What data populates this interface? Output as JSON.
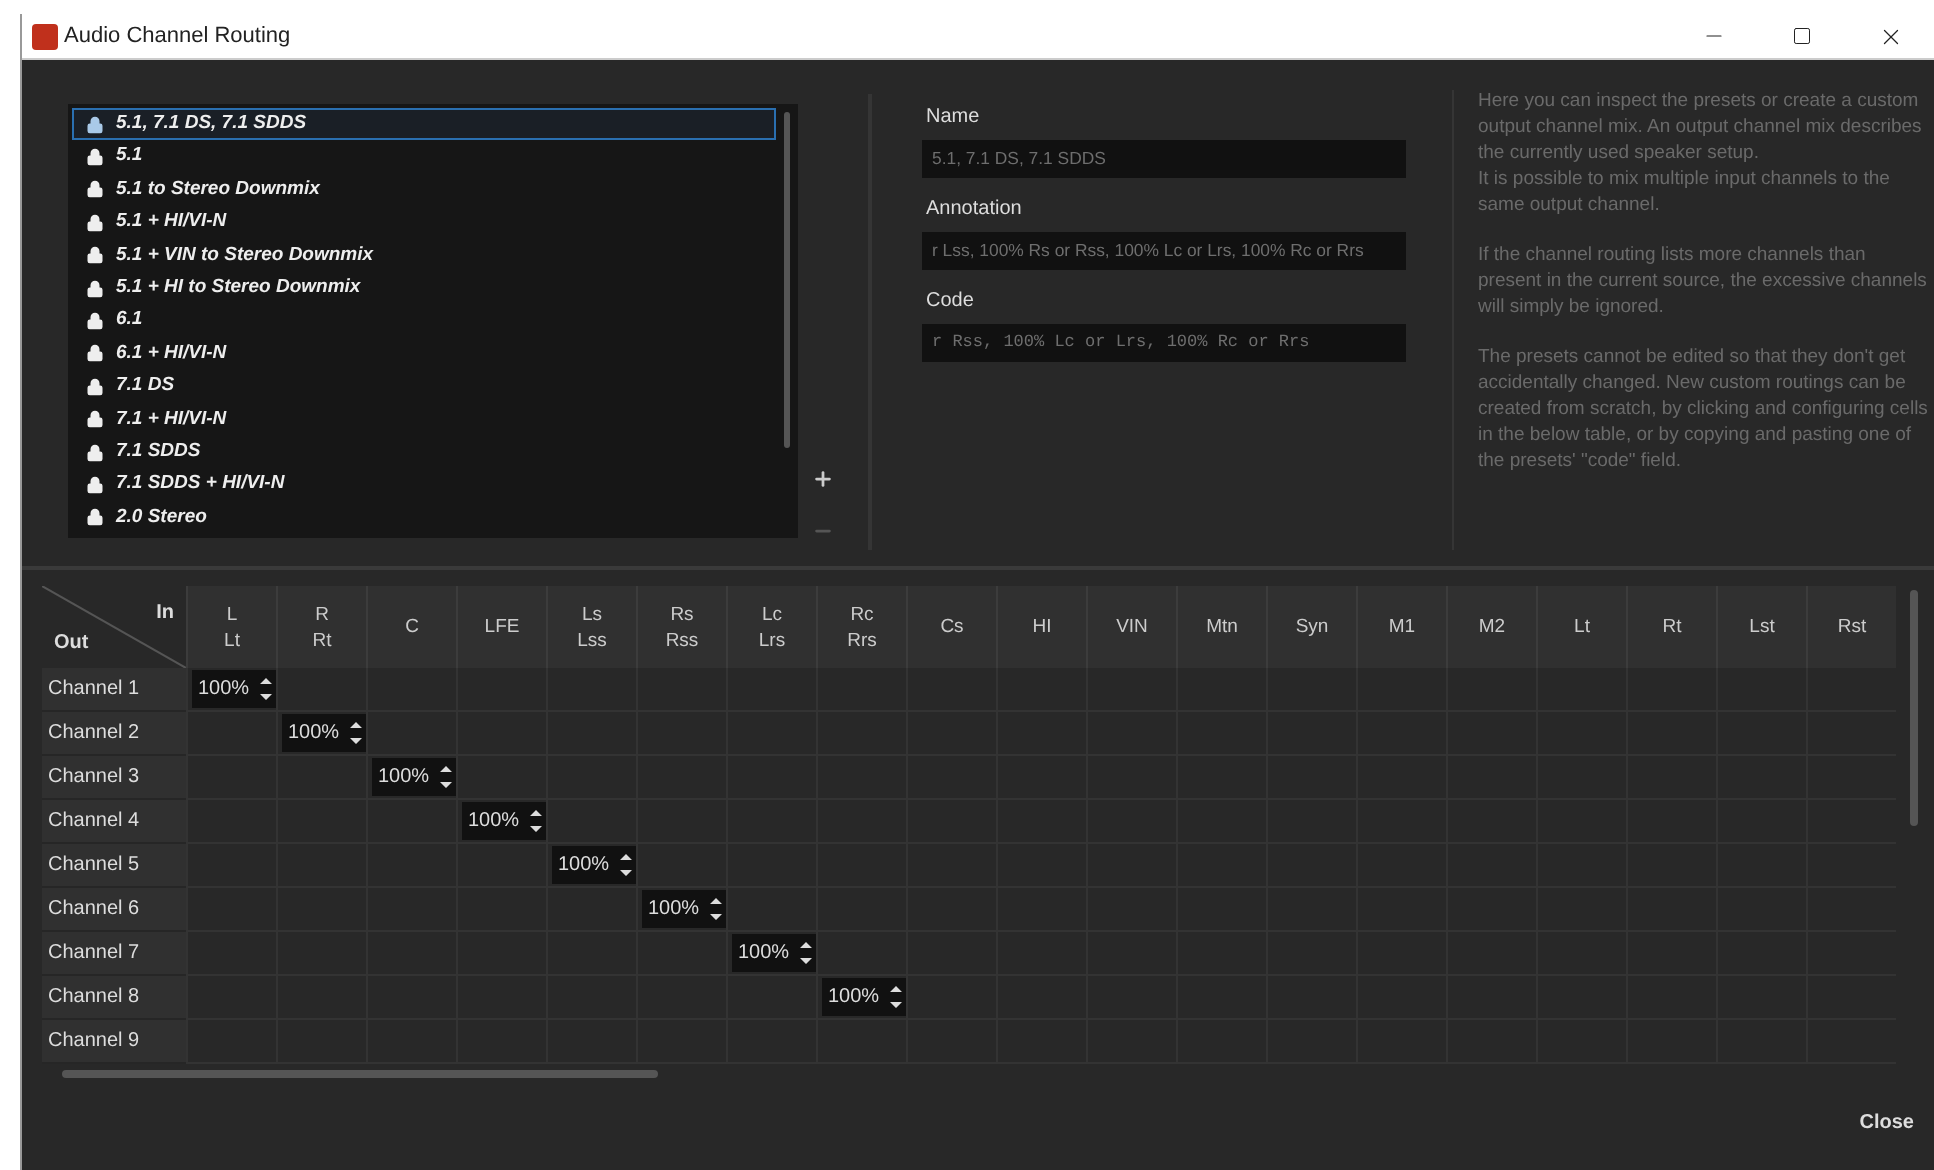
{
  "window": {
    "title": "Audio Channel Routing"
  },
  "presets": [
    {
      "label": "5.1, 7.1 DS, 7.1 SDDS",
      "selected": true
    },
    {
      "label": "5.1",
      "selected": false
    },
    {
      "label": "5.1 to Stereo Downmix",
      "selected": false
    },
    {
      "label": "5.1 + HI/VI-N",
      "selected": false
    },
    {
      "label": "5.1 + VIN to Stereo Downmix",
      "selected": false
    },
    {
      "label": "5.1 + HI to Stereo Downmix",
      "selected": false
    },
    {
      "label": "6.1",
      "selected": false
    },
    {
      "label": "6.1 + HI/VI-N",
      "selected": false
    },
    {
      "label": "7.1 DS",
      "selected": false
    },
    {
      "label": "7.1 + HI/VI-N",
      "selected": false
    },
    {
      "label": "7.1 SDDS",
      "selected": false
    },
    {
      "label": "7.1 SDDS + HI/VI-N",
      "selected": false
    },
    {
      "label": "2.0 Stereo",
      "selected": false
    }
  ],
  "add_button": {
    "disabled": false
  },
  "remove_button": {
    "disabled": true
  },
  "fields": [
    {
      "kind": "text",
      "label": "Name",
      "value": "5.1, 7.1 DS, 7.1 SDDS"
    },
    {
      "kind": "text",
      "label": "Annotation",
      "value": "r Lss, 100% Rs or Rss, 100% Lc or Lrs, 100% Rc or Rrs"
    },
    {
      "kind": "code",
      "label": "Code",
      "value": "r Rss, 100% Lc or Lrs, 100% Rc or Rrs"
    }
  ],
  "help": [
    [
      "Here you can inspect the presets or create a custom output channel mix. An output channel mix describes the currently used speaker setup.",
      "It is possible to mix multiple input channels to the same output channel."
    ],
    [
      "If the channel routing lists more channels than present in the current source, the excessive channels will simply be ignored."
    ],
    [
      "The presets cannot be edited so that they don't get accidentally changed. New custom routings can be created from scratch, by clicking and configuring cells in the below table, or by copying and pasting one of the presets' \"code\" field."
    ]
  ],
  "table": {
    "corner_in": "In",
    "corner_out": "Out",
    "columns": [
      "L\nLt",
      "R\nRt",
      "C",
      "LFE",
      "Ls\nLss",
      "Rs\nRss",
      "Lc\nLrs",
      "Rc\nRrs",
      "Cs",
      "HI",
      "VIN",
      "Mtn",
      "Syn",
      "M1",
      "M2",
      "Lt",
      "Rt",
      "Lst",
      "Rst"
    ],
    "rows": [
      {
        "label": "Channel 1",
        "cells": [
          "100%",
          null,
          null,
          null,
          null,
          null,
          null,
          null,
          null,
          null,
          null,
          null,
          null,
          null,
          null,
          null,
          null,
          null,
          null
        ]
      },
      {
        "label": "Channel 2",
        "cells": [
          null,
          "100%",
          null,
          null,
          null,
          null,
          null,
          null,
          null,
          null,
          null,
          null,
          null,
          null,
          null,
          null,
          null,
          null,
          null
        ]
      },
      {
        "label": "Channel 3",
        "cells": [
          null,
          null,
          "100%",
          null,
          null,
          null,
          null,
          null,
          null,
          null,
          null,
          null,
          null,
          null,
          null,
          null,
          null,
          null,
          null
        ]
      },
      {
        "label": "Channel 4",
        "cells": [
          null,
          null,
          null,
          "100%",
          null,
          null,
          null,
          null,
          null,
          null,
          null,
          null,
          null,
          null,
          null,
          null,
          null,
          null,
          null
        ]
      },
      {
        "label": "Channel 5",
        "cells": [
          null,
          null,
          null,
          null,
          "100%",
          null,
          null,
          null,
          null,
          null,
          null,
          null,
          null,
          null,
          null,
          null,
          null,
          null,
          null
        ]
      },
      {
        "label": "Channel 6",
        "cells": [
          null,
          null,
          null,
          null,
          null,
          "100%",
          null,
          null,
          null,
          null,
          null,
          null,
          null,
          null,
          null,
          null,
          null,
          null,
          null
        ]
      },
      {
        "label": "Channel 7",
        "cells": [
          null,
          null,
          null,
          null,
          null,
          null,
          "100%",
          null,
          null,
          null,
          null,
          null,
          null,
          null,
          null,
          null,
          null,
          null,
          null
        ]
      },
      {
        "label": "Channel 8",
        "cells": [
          null,
          null,
          null,
          null,
          null,
          null,
          null,
          "100%",
          null,
          null,
          null,
          null,
          null,
          null,
          null,
          null,
          null,
          null,
          null
        ]
      },
      {
        "label": "Channel 9",
        "cells": [
          null,
          null,
          null,
          null,
          null,
          null,
          null,
          null,
          null,
          null,
          null,
          null,
          null,
          null,
          null,
          null,
          null,
          null,
          null
        ]
      }
    ]
  },
  "close_button": "Close"
}
